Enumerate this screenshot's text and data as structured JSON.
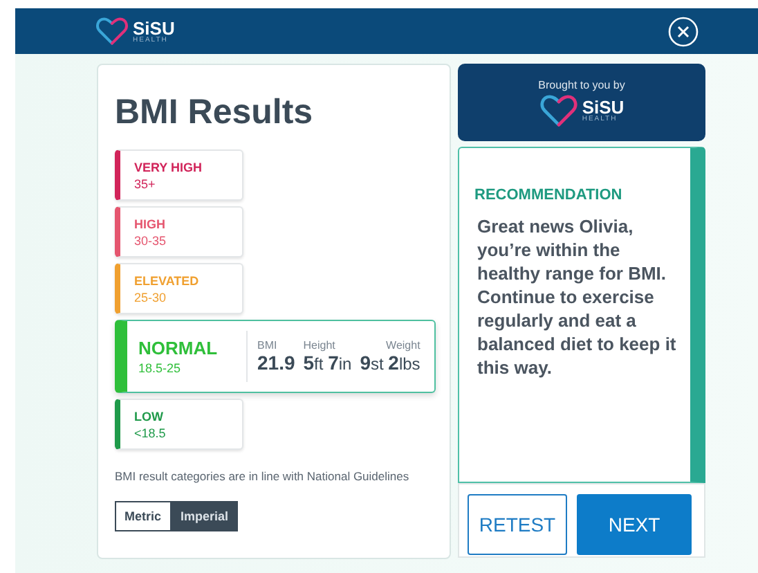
{
  "header": {
    "logo": {
      "name": "SiSU",
      "sub": "HEALTH"
    }
  },
  "results": {
    "title": "BMI Results",
    "categories": [
      {
        "name": "VERY HIGH",
        "range": "35+",
        "color": "#d1245a",
        "selected": false
      },
      {
        "name": "HIGH",
        "range": "30-35",
        "color": "#e5566f",
        "selected": false
      },
      {
        "name": "ELEVATED",
        "range": "25-30",
        "color": "#f0a030",
        "selected": false
      },
      {
        "name": "NORMAL",
        "range": "18.5-25",
        "color": "#2fbf3a",
        "selected": true
      },
      {
        "name": "LOW",
        "range": "<18.5",
        "color": "#1f9a4a",
        "selected": false
      }
    ],
    "readings": [
      {
        "label": "BMI",
        "value": "**21.9**"
      },
      {
        "label": "Height",
        "value": "**5**ft **7**in"
      },
      {
        "label": "Weight",
        "value": "**9**st **2**lbs"
      }
    ],
    "note": "BMI result categories are in line with National Guidelines",
    "units": [
      {
        "label": "Metric",
        "selected": false
      },
      {
        "label": "Imperial",
        "selected": true
      }
    ]
  },
  "sponsor": {
    "caption": "Brought to you by",
    "logo": {
      "name": "SiSU",
      "sub": "HEALTH"
    }
  },
  "recommendation": {
    "heading": "RECOMMENDATION",
    "text": "Great news Olivia, you’re within the healthy range for BMI. Continue to exercise regularly and eat a balanced diet to keep it this way."
  },
  "buttons": [
    {
      "label": "RETEST",
      "kind": "secondary"
    },
    {
      "label": "NEXT",
      "kind": "primary"
    }
  ]
}
